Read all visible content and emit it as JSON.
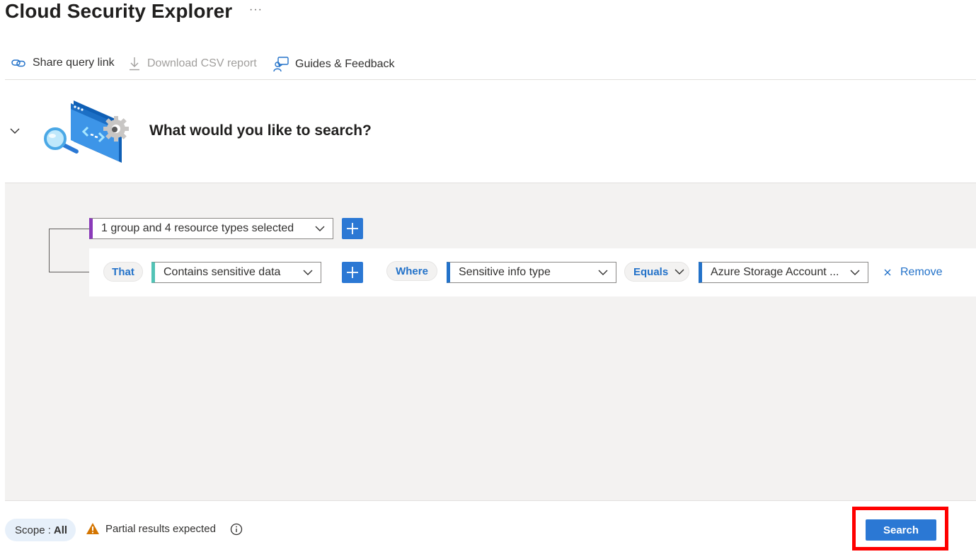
{
  "header": {
    "title": "Cloud Security Explorer",
    "more_label": "···"
  },
  "toolbar": {
    "share_label": "Share query link",
    "share_icon": "link-icon",
    "download_label": "Download CSV report",
    "download_icon": "download-icon",
    "download_disabled": true,
    "guides_label": "Guides & Feedback",
    "guides_icon": "person-feedback-icon"
  },
  "hero": {
    "heading": "What would you like to search?",
    "illustration": "search-code-illustration"
  },
  "query": {
    "resource_selector": "1 group and 4 resource types selected",
    "condition": {
      "that_label": "That",
      "relation": "Contains sensitive data",
      "where_label": "Where",
      "property": "Sensitive info type",
      "operator": "Equals",
      "value": "Azure Storage Account ...",
      "remove_label": "Remove"
    }
  },
  "footer": {
    "scope_label": "Scope :",
    "scope_value": "All",
    "warning_text": "Partial results expected",
    "search_label": "Search"
  },
  "colors": {
    "accent": "#2b78d4",
    "link": "#2372c9",
    "resource_marker": "#8a3ab9",
    "relation_marker": "#52c3b6",
    "warning": "#d47500",
    "highlight": "#ff0000"
  }
}
